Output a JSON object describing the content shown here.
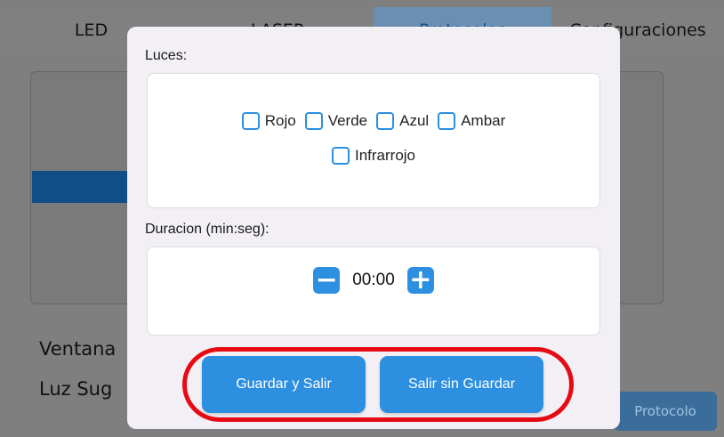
{
  "tabs": [
    {
      "label": "LED"
    },
    {
      "label": "LASER"
    },
    {
      "label": "Protocolos"
    },
    {
      "label": "Configuraciones"
    }
  ],
  "background": {
    "line1": "Ventana",
    "line2": "Luz Sug",
    "protocol_button": "Protocolo"
  },
  "modal": {
    "lights_label": "Luces:",
    "lights": [
      {
        "label": "Rojo",
        "checked": false
      },
      {
        "label": "Verde",
        "checked": false
      },
      {
        "label": "Azul",
        "checked": false
      },
      {
        "label": "Ambar",
        "checked": false
      },
      {
        "label": "Infrarrojo",
        "checked": false
      }
    ],
    "duration_label": "Duracion (min:seg):",
    "duration_value": "00:00",
    "minus_symbol": "−",
    "plus_symbol": "+",
    "save_button": "Guardar y Salir",
    "exit_button": "Salir sin Guardar"
  },
  "colors": {
    "accent": "#2d8fe0",
    "highlight": "#e60a12"
  }
}
